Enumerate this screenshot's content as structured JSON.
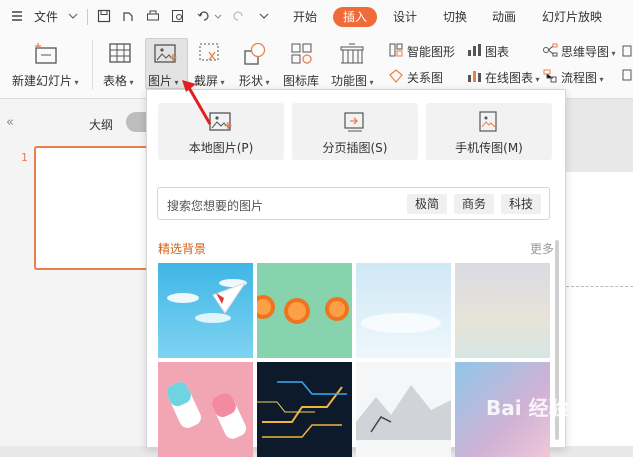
{
  "menubar": {
    "file_label": "文件",
    "tabs": [
      "开始",
      "插入",
      "设计",
      "切换",
      "动画",
      "幻灯片放映"
    ],
    "active_tab": "插入"
  },
  "ribbon": {
    "new_slide": "新建幻灯片",
    "table": "表格",
    "picture": "图片",
    "screenshot": "截屏",
    "shape": "形状",
    "icon_library": "图标库",
    "function_chart": "功能图",
    "smart_graphic": "智能图形",
    "chart": "图表",
    "mind_map": "思维导图",
    "relation_chart": "关系图",
    "online_chart": "在线图表",
    "flowchart": "流程图"
  },
  "left_panel": {
    "outline_tab": "大纲",
    "slide_number": "1"
  },
  "picture_panel": {
    "local_picture": "本地图片(P)",
    "page_illustration": "分页插图(S)",
    "phone_picture": "手机传图(M)",
    "search_placeholder": "搜索您想要的图片",
    "tags": [
      "极简",
      "商务",
      "科技"
    ],
    "section_title": "精选背景",
    "more_label": "更多"
  },
  "watermark": "Bai 经验",
  "colors": {
    "accent": "#ef6c3a",
    "section_title": "#d2601a",
    "arrow": "#e02020"
  }
}
